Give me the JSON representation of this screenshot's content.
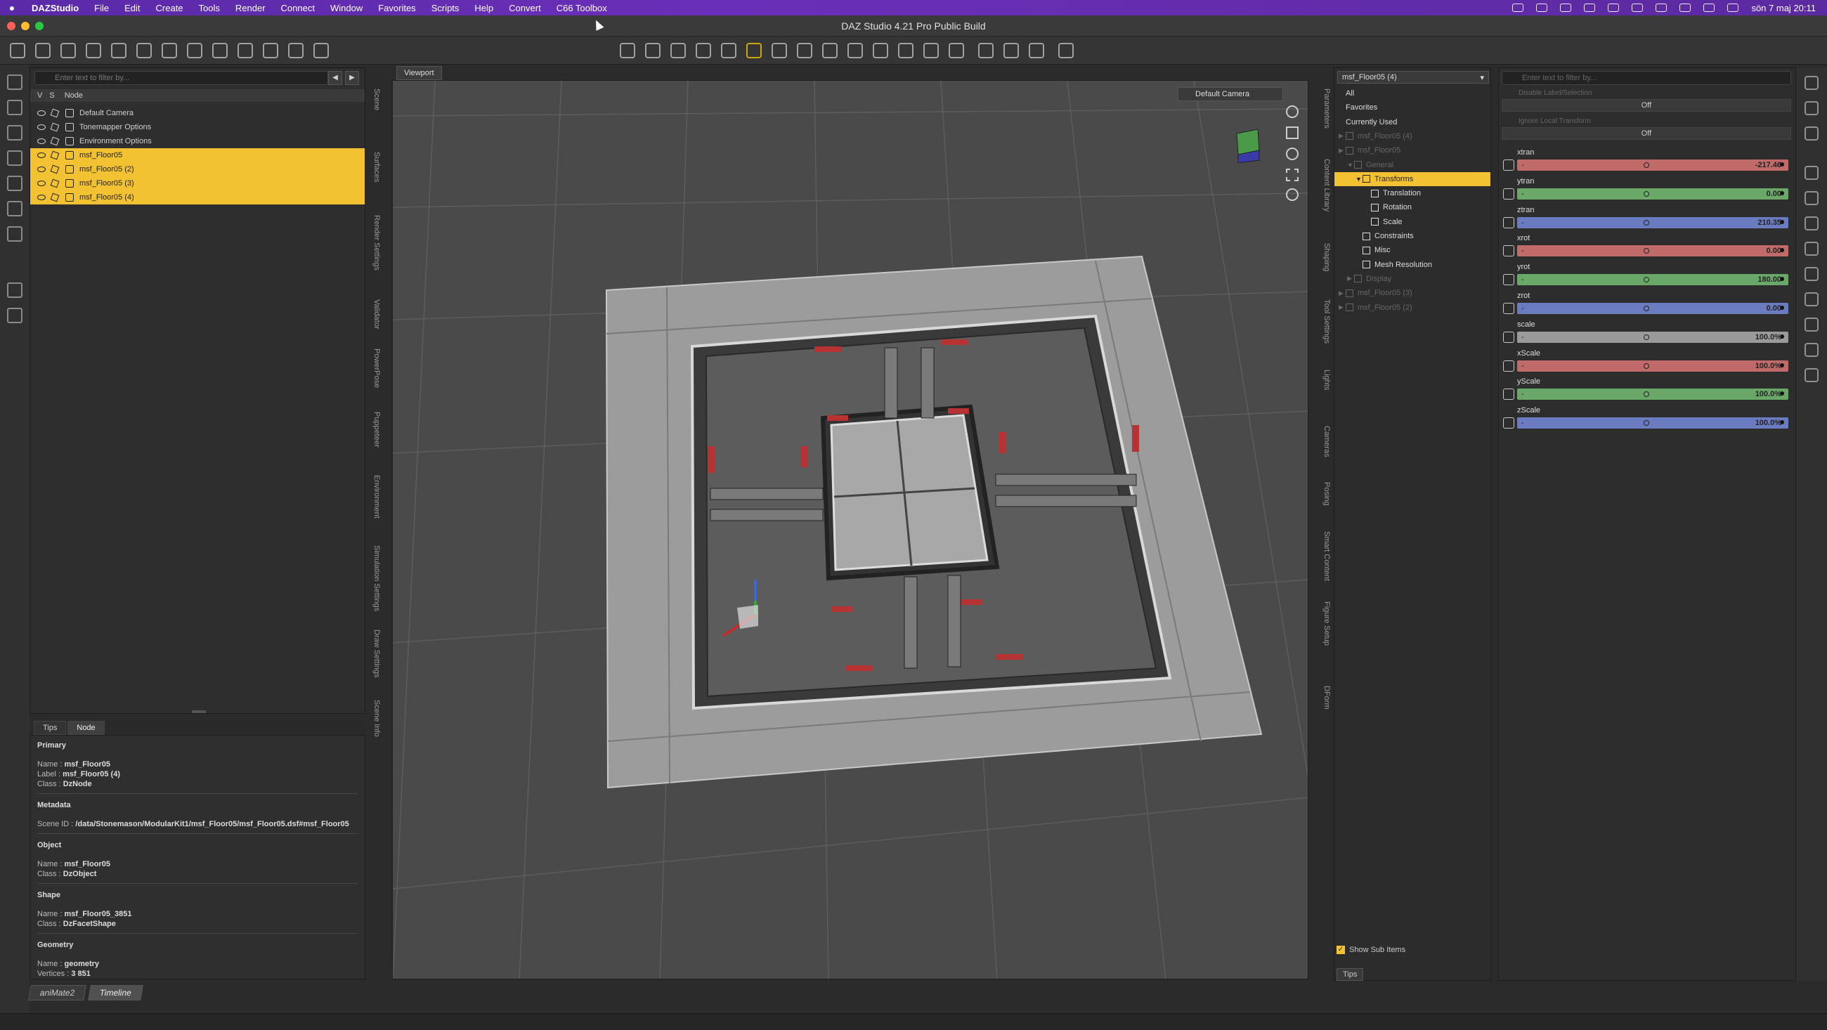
{
  "menubar": {
    "app_name": "DAZStudio",
    "items": [
      "File",
      "Edit",
      "Create",
      "Tools",
      "Render",
      "Connect",
      "Window",
      "Favorites",
      "Scripts",
      "Help",
      "Convert",
      "C66 Toolbox"
    ],
    "clock": "sön 7 maj  20:11"
  },
  "window": {
    "title": "DAZ Studio 4.21 Pro Public Build"
  },
  "scene": {
    "filter_placeholder": "Enter text to filter by...",
    "header": {
      "v": "V",
      "s": "S",
      "node": "Node"
    },
    "rows": [
      {
        "label": "Default Camera",
        "selected": false
      },
      {
        "label": "Tonemapper Options",
        "selected": false
      },
      {
        "label": "Environment Options",
        "selected": false
      },
      {
        "label": "msf_Floor05",
        "selected": true
      },
      {
        "label": "msf_Floor05 (2)",
        "selected": true
      },
      {
        "label": "msf_Floor05 (3)",
        "selected": true
      },
      {
        "label": "msf_Floor05 (4)",
        "selected": true
      }
    ],
    "side_tabs": [
      "Scene",
      "Surfaces",
      "Render Settings",
      "Validator",
      "PowerPose",
      "Puppeteer",
      "Environment",
      "Simulation Settings",
      "Draw Settings",
      "Scene Info"
    ]
  },
  "node_info": {
    "tabs": [
      "Tips",
      "Node"
    ],
    "active_tab": "Node",
    "primary": {
      "title": "Primary",
      "name_key": "Name :",
      "name": "msf_Floor05",
      "label_key": "Label :",
      "label": "msf_Floor05 (4)",
      "class_key": "Class :",
      "class": "DzNode"
    },
    "metadata": {
      "title": "Metadata",
      "scene_id_key": "Scene ID :",
      "scene_id": "/data/Stonemason/ModularKit1/msf_Floor05/msf_Floor05.dsf#msf_Floor05"
    },
    "object": {
      "title": "Object",
      "name_key": "Name :",
      "name": "msf_Floor05",
      "class_key": "Class :",
      "class": "DzObject"
    },
    "shape": {
      "title": "Shape",
      "name_key": "Name :",
      "name": "msf_Floor05_3851",
      "class_key": "Class :",
      "class": "DzFacetShape"
    },
    "geometry": {
      "title": "Geometry",
      "name_key": "Name :",
      "name": "geometry",
      "vertices_key": "Vertices :",
      "vertices": "3 851"
    }
  },
  "viewport": {
    "tab_label": "Viewport",
    "camera": "Default Camera"
  },
  "parameters": {
    "node_select": "msf_Floor05 (4)",
    "tree": [
      {
        "label": "All",
        "indent": 0,
        "dim": false,
        "selected": false,
        "expander": ""
      },
      {
        "label": "Favorites",
        "indent": 0,
        "dim": false,
        "selected": false,
        "expander": ""
      },
      {
        "label": "Currently Used",
        "indent": 0,
        "dim": false,
        "selected": false,
        "expander": ""
      },
      {
        "label": "msf_Floor05 (4)",
        "indent": 0,
        "dim": true,
        "selected": false,
        "expander": "▶"
      },
      {
        "label": "msf_Floor05",
        "indent": 0,
        "dim": true,
        "selected": false,
        "expander": "▶"
      },
      {
        "label": "General",
        "indent": 1,
        "dim": true,
        "selected": false,
        "expander": "▼"
      },
      {
        "label": "Transforms",
        "indent": 2,
        "dim": false,
        "selected": true,
        "expander": "▼"
      },
      {
        "label": "Translation",
        "indent": 3,
        "dim": false,
        "selected": false,
        "expander": ""
      },
      {
        "label": "Rotation",
        "indent": 3,
        "dim": false,
        "selected": false,
        "expander": ""
      },
      {
        "label": "Scale",
        "indent": 3,
        "dim": false,
        "selected": false,
        "expander": ""
      },
      {
        "label": "Constraints",
        "indent": 2,
        "dim": false,
        "selected": false,
        "expander": ""
      },
      {
        "label": "Misc",
        "indent": 2,
        "dim": false,
        "selected": false,
        "expander": ""
      },
      {
        "label": "Mesh Resolution",
        "indent": 2,
        "dim": false,
        "selected": false,
        "expander": ""
      },
      {
        "label": "Display",
        "indent": 1,
        "dim": true,
        "selected": false,
        "expander": "▶"
      },
      {
        "label": "msf_Floor05 (3)",
        "indent": 0,
        "dim": true,
        "selected": false,
        "expander": "▶"
      },
      {
        "label": "msf_Floor05 (2)",
        "indent": 0,
        "dim": true,
        "selected": false,
        "expander": "▶"
      }
    ],
    "show_sub_items": "Show Sub Items",
    "side_tabs": [
      "Parameters",
      "Content Library",
      "Shaping",
      "Tool Settings",
      "Lights",
      "Cameras",
      "Posing",
      "Smart Content",
      "Figure Setup",
      "DForm"
    ]
  },
  "sliders": {
    "filter_placeholder": "Enter text to filter by...",
    "off_rows": [
      {
        "label": "Disable Label/Selection",
        "value": "Off"
      },
      {
        "label": "Ignore Local Transform",
        "value": "Off"
      }
    ],
    "props": [
      {
        "name": "xtran",
        "value": "-217.46",
        "color": "#c06a6a"
      },
      {
        "name": "ytran",
        "value": "0.00",
        "color": "#6aa86a"
      },
      {
        "name": "ztran",
        "value": "210.35",
        "color": "#6a7bc0"
      },
      {
        "name": "xrot",
        "value": "0.00",
        "color": "#c06a6a"
      },
      {
        "name": "yrot",
        "value": "180.00",
        "color": "#6aa86a"
      },
      {
        "name": "zrot",
        "value": "0.00",
        "color": "#6a7bc0"
      },
      {
        "name": "scale",
        "value": "100.0%",
        "color": "#9a9a9a"
      },
      {
        "name": "xScale",
        "value": "100.0%",
        "color": "#c06a6a"
      },
      {
        "name": "yScale",
        "value": "100.0%",
        "color": "#6aa86a"
      },
      {
        "name": "zScale",
        "value": "100.0%",
        "color": "#6a7bc0"
      }
    ]
  },
  "bottom": {
    "tabs": [
      "aniMate2",
      "Timeline"
    ],
    "active_tab": "Timeline",
    "tips_label": "Tips"
  },
  "colors": {
    "selection": "#f2c232",
    "menubar": "#6a2fb8"
  }
}
